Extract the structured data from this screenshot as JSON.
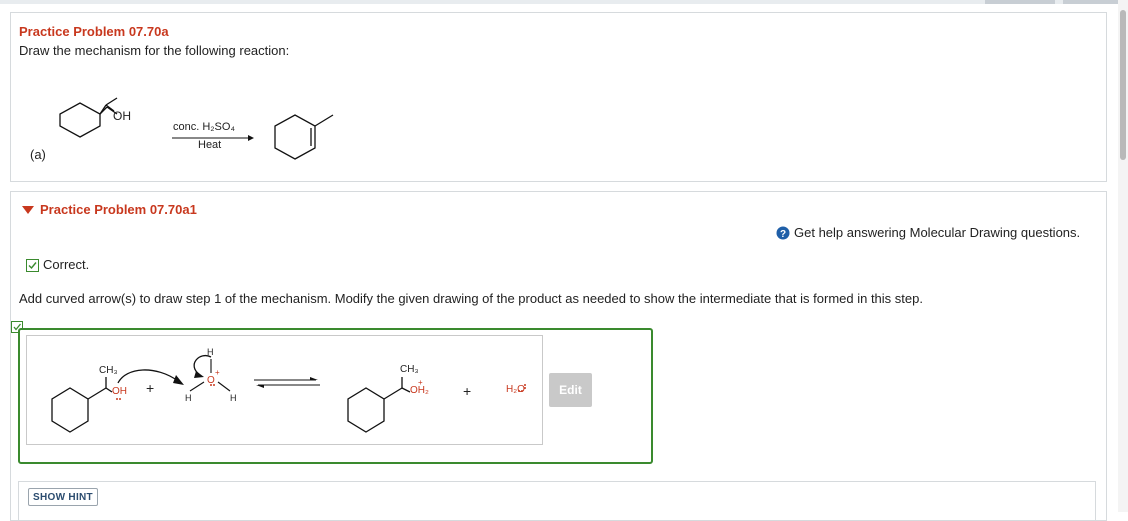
{
  "problem": {
    "title": "Practice Problem 07.70a",
    "instruction": "Draw the mechanism for the following reaction:",
    "part_label": "(a)",
    "reactant_group": "OH",
    "reagent": "conc. H₂SO₄",
    "condition": "Heat"
  },
  "subproblem": {
    "title": "Practice Problem 07.70a1",
    "help_text": "Get help answering Molecular Drawing questions.",
    "status": "Correct.",
    "instruction": "Add curved arrow(s) to draw step 1 of the mechanism. Modify the given drawing of the product as needed to show the intermediate that is formed in this step."
  },
  "drawing": {
    "reactant_labels": {
      "methyl": "CH₃",
      "hydroxyl": "OH",
      "plus": "+"
    },
    "acid_labels": {
      "h_top": "H",
      "o": "O",
      "h_left": "H",
      "h_right": "H",
      "charge": "+"
    },
    "product_labels": {
      "methyl": "CH₃",
      "oxonium": "OH₂",
      "charge": "+",
      "plus": "+",
      "water": "H₂O"
    },
    "edit_label": "Edit"
  },
  "hint": {
    "label": "SHOW HINT"
  },
  "colors": {
    "title_red": "#c8381e",
    "correct_green": "#3a8a2e",
    "help_blue": "#1f5fa8"
  }
}
